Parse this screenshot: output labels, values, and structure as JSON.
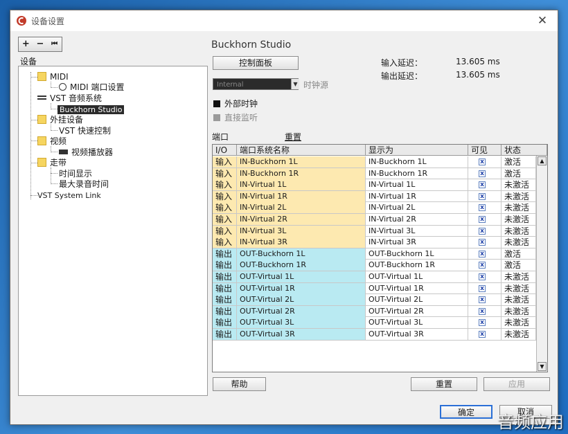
{
  "desktop": {
    "tabs": [
      "",
      ""
    ]
  },
  "window": {
    "title": "设备设置",
    "close_glyph": "✕"
  },
  "tree_toolbar": {
    "add": "+",
    "remove": "−",
    "reset": "⏮"
  },
  "tree": {
    "header": "设备",
    "items": [
      {
        "label": "MIDI",
        "icon": "folder-icon"
      },
      {
        "label": "MIDI 端口设置",
        "icon": "midi-port-icon"
      },
      {
        "label": "VST 音频系统",
        "icon": "audio-connector-icon"
      },
      {
        "label": "Buckhorn Studio",
        "icon": ""
      },
      {
        "label": "外挂设备",
        "icon": "folder-icon"
      },
      {
        "label": "VST 快速控制",
        "icon": ""
      },
      {
        "label": "视频",
        "icon": "folder-icon"
      },
      {
        "label": "视频播放器",
        "icon": "video-camera-icon"
      },
      {
        "label": "走带",
        "icon": "folder-icon"
      },
      {
        "label": "时间显示",
        "icon": ""
      },
      {
        "label": "最大录音时间",
        "icon": ""
      },
      {
        "label": "VST System Link",
        "icon": ""
      }
    ]
  },
  "device": {
    "title": "Buckhorn Studio",
    "control_panel": "控制面板",
    "input_latency_label": "输入延迟：",
    "input_latency_value": "13.605 ms",
    "output_latency_label": "输出延迟：",
    "output_latency_value": "13.605 ms",
    "clock_source_value": "Internal",
    "clock_source_label": "时钟源",
    "external_clock": "外部时钟",
    "direct_monitoring": "直接监听",
    "ports_label": "端口",
    "reset_link": "重置"
  },
  "ports_table": {
    "headers": [
      "I/O",
      "端口系统名称",
      "显示为",
      "可见",
      "状态"
    ],
    "rows": [
      {
        "io": "输入",
        "name": "IN-Buckhorn 1L",
        "display": "IN-Buckhorn 1L",
        "visible": "x",
        "state": "激活"
      },
      {
        "io": "输入",
        "name": "IN-Buckhorn 1R",
        "display": "IN-Buckhorn 1R",
        "visible": "x",
        "state": "激活"
      },
      {
        "io": "输入",
        "name": "IN-Virtual 1L",
        "display": "IN-Virtual 1L",
        "visible": "x",
        "state": "未激活"
      },
      {
        "io": "输入",
        "name": "IN-Virtual 1R",
        "display": "IN-Virtual 1R",
        "visible": "x",
        "state": "未激活"
      },
      {
        "io": "输入",
        "name": "IN-Virtual 2L",
        "display": "IN-Virtual 2L",
        "visible": "x",
        "state": "未激活"
      },
      {
        "io": "输入",
        "name": "IN-Virtual 2R",
        "display": "IN-Virtual 2R",
        "visible": "x",
        "state": "未激活"
      },
      {
        "io": "输入",
        "name": "IN-Virtual 3L",
        "display": "IN-Virtual 3L",
        "visible": "x",
        "state": "未激活"
      },
      {
        "io": "输入",
        "name": "IN-Virtual 3R",
        "display": "IN-Virtual 3R",
        "visible": "x",
        "state": "未激活"
      },
      {
        "io": "输出",
        "name": "OUT-Buckhorn 1L",
        "display": "OUT-Buckhorn 1L",
        "visible": "x",
        "state": "激活"
      },
      {
        "io": "输出",
        "name": "OUT-Buckhorn 1R",
        "display": "OUT-Buckhorn 1R",
        "visible": "x",
        "state": "激活"
      },
      {
        "io": "输出",
        "name": "OUT-Virtual 1L",
        "display": "OUT-Virtual 1L",
        "visible": "x",
        "state": "未激活"
      },
      {
        "io": "输出",
        "name": "OUT-Virtual 1R",
        "display": "OUT-Virtual 1R",
        "visible": "x",
        "state": "未激活"
      },
      {
        "io": "输出",
        "name": "OUT-Virtual 2L",
        "display": "OUT-Virtual 2L",
        "visible": "x",
        "state": "未激活"
      },
      {
        "io": "输出",
        "name": "OUT-Virtual 2R",
        "display": "OUT-Virtual 2R",
        "visible": "x",
        "state": "未激活"
      },
      {
        "io": "输出",
        "name": "OUT-Virtual 3L",
        "display": "OUT-Virtual 3L",
        "visible": "x",
        "state": "未激活"
      },
      {
        "io": "输出",
        "name": "OUT-Virtual 3R",
        "display": "OUT-Virtual 3R",
        "visible": "x",
        "state": "未激活"
      }
    ]
  },
  "bottom_buttons": {
    "help": "帮助",
    "reset": "重置",
    "apply": "应用"
  },
  "footer_buttons": {
    "ok": "确定",
    "cancel": "取消"
  },
  "watermark": "音频应用",
  "colors": {
    "input_row": "#fde9b0",
    "output_row": "#b9eaf2",
    "selection": "#2b2b2b",
    "folder": "#f6d560"
  }
}
